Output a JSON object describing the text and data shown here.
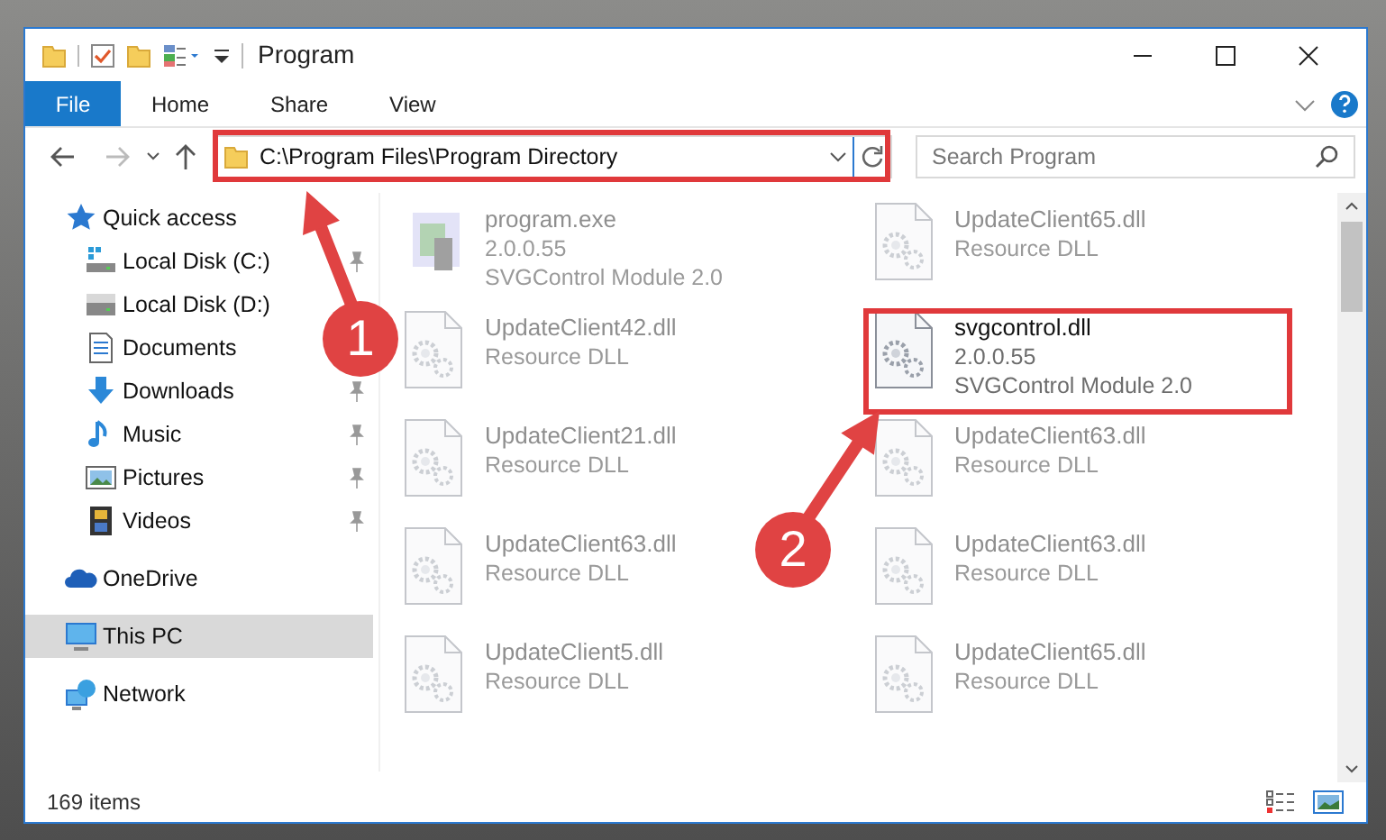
{
  "window": {
    "title": "Program"
  },
  "ribbon": {
    "tabs": [
      {
        "label": "File",
        "kind": "file"
      },
      {
        "label": "Home",
        "kind": "tab",
        "selected": false
      },
      {
        "label": "Share",
        "kind": "tab",
        "selected": false
      },
      {
        "label": "View",
        "kind": "tab",
        "selected": false
      }
    ]
  },
  "address_bar": {
    "path": "C:\\Program Files\\Program Directory"
  },
  "search": {
    "placeholder": "Search Program"
  },
  "sidebar": {
    "items": [
      {
        "label": "Quick access",
        "kind": "star",
        "selected": false,
        "children": [
          {
            "label": "Local Disk (C:)",
            "kind": "disk-c",
            "pinned": true
          },
          {
            "label": "Local Disk (D:)",
            "kind": "disk"
          },
          {
            "label": "Documents",
            "kind": "documents"
          },
          {
            "label": "Downloads",
            "kind": "downloads",
            "pinned": true
          },
          {
            "label": "Music",
            "kind": "music",
            "pinned": true
          },
          {
            "label": "Pictures",
            "kind": "pictures",
            "pinned": true
          },
          {
            "label": "Videos",
            "kind": "videos",
            "pinned": true
          }
        ]
      },
      {
        "label": "OneDrive",
        "kind": "cloud",
        "selected": false
      },
      {
        "label": "This PC",
        "kind": "pc",
        "selected": true
      },
      {
        "label": "Network",
        "kind": "network",
        "selected": false
      }
    ]
  },
  "files": [
    {
      "name": "program.exe",
      "details": [
        "2.0.0.55",
        "SVGControl Module 2.0"
      ],
      "kind": "exe",
      "faded": true
    },
    {
      "name": "UpdateClient65.dll",
      "details": [
        "Resource DLL"
      ],
      "kind": "dll",
      "faded": true
    },
    {
      "name": "UpdateClient42.dll",
      "details": [
        "Resource DLL"
      ],
      "kind": "dll",
      "faded": true
    },
    {
      "name": "svgcontrol.dll",
      "details": [
        "2.0.0.55",
        "SVGControl Module 2.0"
      ],
      "kind": "dll",
      "faded": false
    },
    {
      "name": "UpdateClient21.dll",
      "details": [
        "Resource DLL"
      ],
      "kind": "dll",
      "faded": true
    },
    {
      "name": "UpdateClient63.dll",
      "details": [
        "Resource DLL"
      ],
      "kind": "dll",
      "faded": true
    },
    {
      "name": "UpdateClient63.dll",
      "details": [
        "Resource DLL"
      ],
      "kind": "dll",
      "faded": true
    },
    {
      "name": "UpdateClient63.dll",
      "details": [
        "Resource DLL"
      ],
      "kind": "dll",
      "faded": true
    },
    {
      "name": "UpdateClient5.dll",
      "details": [
        "Resource DLL"
      ],
      "kind": "dll",
      "faded": true
    },
    {
      "name": "UpdateClient65.dll",
      "details": [
        "Resource DLL"
      ],
      "kind": "dll",
      "faded": true
    }
  ],
  "status_bar": {
    "count": "169 items"
  },
  "annotations": [
    {
      "label": "1"
    },
    {
      "label": "2"
    }
  ]
}
